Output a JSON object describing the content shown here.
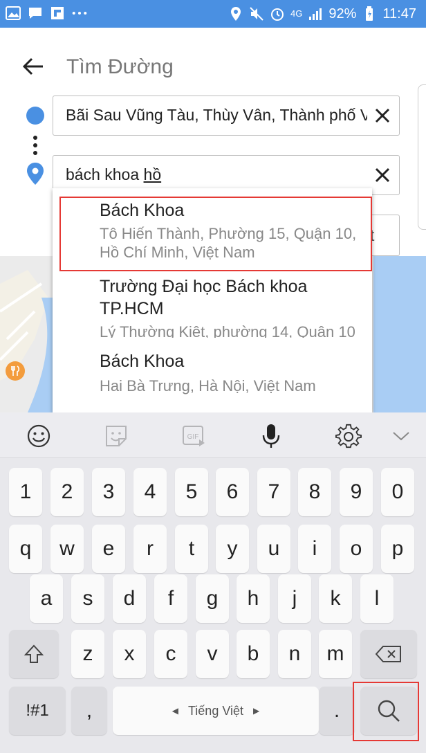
{
  "status_bar": {
    "battery": "92%",
    "time": "11:47",
    "network": "4G",
    "icons_left": [
      "image-icon",
      "message-icon",
      "flipboard-icon",
      "more-dots-icon"
    ],
    "icons_right": [
      "location-icon",
      "mute-icon",
      "alarm-icon",
      "signal-icon",
      "battery-icon"
    ]
  },
  "header": {
    "title": "Tìm Đường"
  },
  "route": {
    "origin_value": "Bãi Sau Vũng Tàu, Thùy Vân, Thành phố V",
    "destination_value_plain": "bách khoa ",
    "destination_value_underlined": "hồ",
    "hidden_button_char": "t"
  },
  "suggestions": [
    {
      "name": "Bách Khoa",
      "address": "Tô Hiến Thành, Phường 15, Quận 10, Hồ Chí Minh, Việt Nam"
    },
    {
      "name": "Trường Đại học Bách khoa TP.HCM",
      "address": "Lý Thường Kiệt, phường 14, Quận 10"
    },
    {
      "name": "Bách Khoa",
      "address": "Hai Bà Trưng, Hà Nội, Việt Nam"
    }
  ],
  "keyboard": {
    "toolbar": [
      "emoji-icon",
      "sticker-icon",
      "gif-icon",
      "microphone-icon",
      "settings-icon",
      "collapse-icon"
    ],
    "row_numbers": [
      "1",
      "2",
      "3",
      "4",
      "5",
      "6",
      "7",
      "8",
      "9",
      "0"
    ],
    "row_1": [
      "q",
      "w",
      "e",
      "r",
      "t",
      "y",
      "u",
      "i",
      "o",
      "p"
    ],
    "row_2": [
      "a",
      "s",
      "d",
      "f",
      "g",
      "h",
      "j",
      "k",
      "l"
    ],
    "row_3": [
      "z",
      "x",
      "c",
      "v",
      "b",
      "n",
      "m"
    ],
    "symbols_label": "!#1",
    "comma": ",",
    "space_label": "Tiếng Việt",
    "period": "."
  },
  "colors": {
    "status_bar": "#4a90e2",
    "highlight": "#e53935",
    "origin_dot": "#4a90e2"
  }
}
